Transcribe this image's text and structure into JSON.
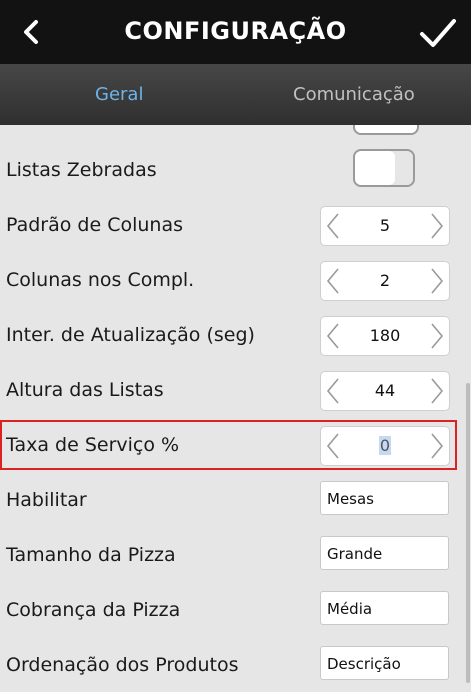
{
  "header": {
    "title": "CONFIGURAÇÃO",
    "back_icon": "chevron-left-icon",
    "confirm_icon": "check-icon"
  },
  "tabs": [
    {
      "label": "Geral",
      "active": true
    },
    {
      "label": "Comunicação",
      "active": false
    }
  ],
  "settings": {
    "listas_zebradas": {
      "label": "Listas Zebradas",
      "enabled": false
    },
    "padrao_colunas": {
      "label": "Padrão de Colunas",
      "value": "5"
    },
    "colunas_compl": {
      "label": "Colunas nos Compl.",
      "value": "2"
    },
    "intervalo": {
      "label": "Inter. de Atualização (seg)",
      "value": "180"
    },
    "altura_listas": {
      "label": "Altura das Listas",
      "value": "44"
    },
    "taxa_servico": {
      "label": "Taxa de Serviço %",
      "value": "0"
    },
    "habilitar": {
      "label": "Habilitar",
      "value": "Mesas"
    },
    "tamanho_pizza": {
      "label": "Tamanho da Pizza",
      "value": "Grande"
    },
    "cobranca_pizza": {
      "label": "Cobrança da Pizza",
      "value": "Média"
    },
    "ordenacao": {
      "label": "Ordenação dos Produtos",
      "value": "Descrição"
    }
  },
  "colors": {
    "header_bg": "#121212",
    "active_tab": "#6fb3e8",
    "inactive_tab": "#c0c0c0",
    "highlight": "#dd2222"
  }
}
